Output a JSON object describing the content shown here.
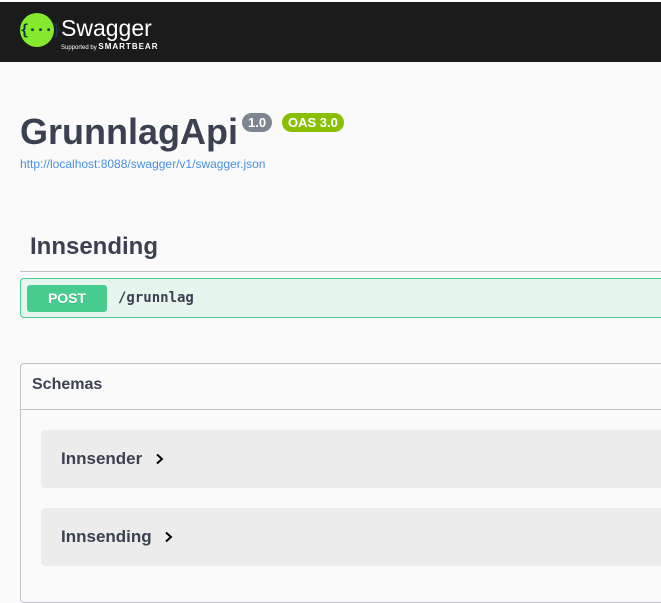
{
  "topbar": {
    "logo_glyph": "{···}",
    "brand_name": "Swagger",
    "brand_sub_prefix": "Supported by",
    "brand_sub_company": "SMARTBEAR",
    "brand_color": "#85ea2d",
    "background_color": "#1b1b1b"
  },
  "info": {
    "title": "GrunnlagApi",
    "version_badge": "1.0",
    "oas_badge": "OAS 3.0",
    "spec_url": "http://localhost:8088/swagger/v1/swagger.json"
  },
  "tags": [
    {
      "name": "Innsending",
      "operations": [
        {
          "method": "POST",
          "path": "/grunnlag",
          "color": "#49cc90"
        }
      ]
    }
  ],
  "schemas": {
    "title": "Schemas",
    "models": [
      {
        "name": "Innsender",
        "icon": "chevron-right-icon"
      },
      {
        "name": "Innsending",
        "icon": "chevron-right-icon"
      }
    ]
  }
}
